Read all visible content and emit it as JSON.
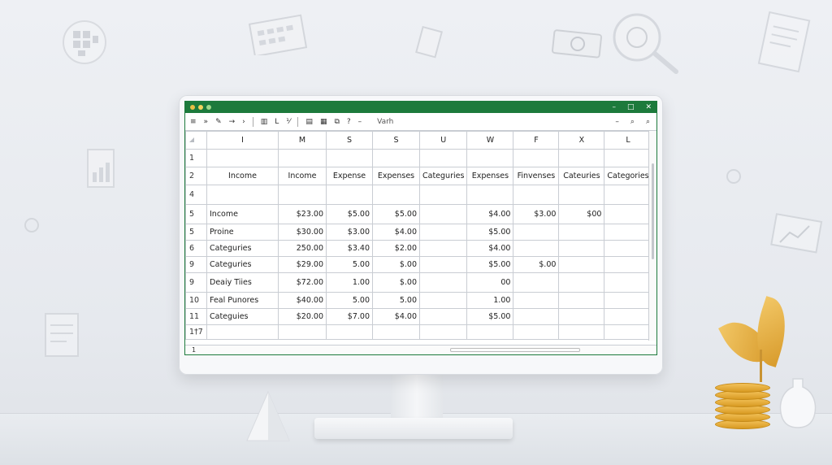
{
  "window": {
    "controls": [
      "–",
      "□",
      "✕"
    ],
    "dot_colors": [
      "#e9c046",
      "#f4d35e",
      "#9fd88a"
    ]
  },
  "toolbar": {
    "items": [
      "≡",
      "»",
      "✎",
      "→",
      "›",
      "▥",
      "L",
      "⅟",
      "▤",
      "▦",
      "⧉",
      "?",
      "–"
    ],
    "label": "Varh",
    "right": [
      "–",
      "⌕",
      "⌕"
    ]
  },
  "grid": {
    "corner": "",
    "columns": [
      "I",
      "M",
      "S",
      "S",
      "U",
      "W",
      "F",
      "X",
      "L"
    ],
    "rows": [
      {
        "num": "1",
        "cells": [
          "",
          "",
          "",
          "",
          "",
          "",
          "",
          "",
          ""
        ]
      },
      {
        "num": "2",
        "cells": [
          "Income",
          "Income",
          "Expense",
          "Expenses",
          "Categuries",
          "Expenses",
          "Finvenses",
          "Cateuries",
          "Categories"
        ]
      },
      {
        "num": "4",
        "cells": [
          "",
          "",
          "",
          "",
          "",
          "",
          "",
          "",
          ""
        ]
      },
      {
        "num": "5",
        "cells": [
          "Income",
          "$23.00",
          "$5.00",
          "$5.00",
          "",
          "$4.00",
          "$3.00",
          "$00",
          ""
        ]
      },
      {
        "num": "5",
        "cells": [
          "Proine",
          "$30.00",
          "$3.00",
          "$4.00",
          "",
          "$5.00",
          "",
          "",
          ""
        ]
      },
      {
        "num": "6",
        "cells": [
          "Categuries",
          "250.00",
          "$3.40",
          "$2.00",
          "",
          "$4.00",
          "",
          "",
          ""
        ]
      },
      {
        "num": "9",
        "cells": [
          "Categuries",
          "$29.00",
          "5.00",
          "$.00",
          "",
          "$5.00",
          "$.00",
          "",
          ""
        ]
      },
      {
        "num": "9",
        "cells": [
          "Deaiy Tiies",
          "$72.00",
          "1.00",
          "$.00",
          "",
          "00",
          "",
          "",
          ""
        ]
      },
      {
        "num": "10",
        "cells": [
          "Feal Punores",
          "$40.00",
          "5.00",
          "5.00",
          "",
          "1.00",
          "",
          "",
          ""
        ]
      },
      {
        "num": "11",
        "cells": [
          "Categuies",
          "$20.00",
          "$7.00",
          "$4.00",
          "",
          "$5.00",
          "",
          "",
          ""
        ]
      },
      {
        "num": "1†7",
        "cells": [
          "",
          "",
          "",
          "",
          "",
          "",
          "",
          "",
          ""
        ]
      }
    ],
    "footer_row": "1"
  },
  "colors": {
    "accent": "#1d7a3c",
    "coin": "#e8b040"
  }
}
